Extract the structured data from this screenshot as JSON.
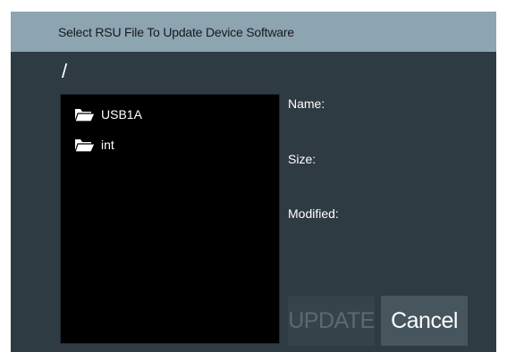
{
  "dialog": {
    "title": "Select RSU File To Update Device Software",
    "current_path": "/"
  },
  "file_list": {
    "items": [
      {
        "label": "USB1A",
        "icon": "folder-open-icon"
      },
      {
        "label": "int",
        "icon": "folder-open-icon"
      }
    ]
  },
  "details": {
    "name_label": "Name:",
    "size_label": "Size:",
    "modified_label": "Modified:"
  },
  "buttons": {
    "update_label": "UPDATE",
    "update_enabled": false,
    "cancel_label": "Cancel"
  },
  "colors": {
    "title_bar": "#8da4b1",
    "dialog_background": "#2f3b42",
    "list_background": "#000000",
    "button_disabled": "#37434a",
    "button_normal": "#46555e"
  }
}
